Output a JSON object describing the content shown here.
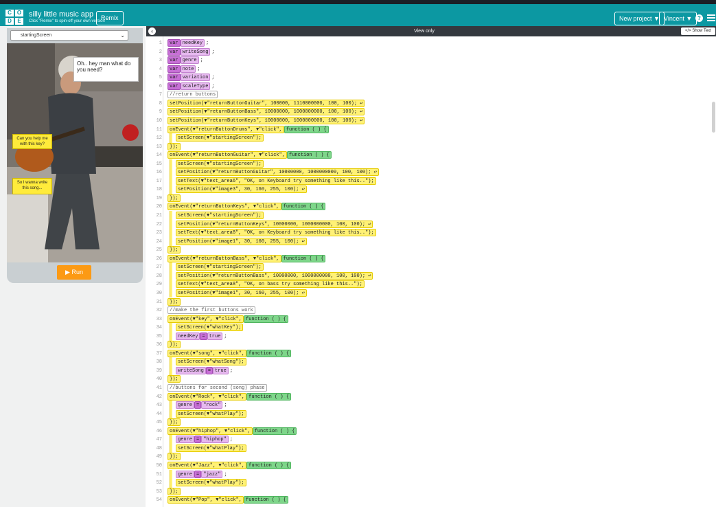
{
  "app": {
    "logo_letters": [
      "C",
      "O",
      "D",
      "E"
    ],
    "title": "silly little music app",
    "subtitle": "Click \"Remix\" to spin-off your own version",
    "remix_label": "Remix",
    "new_project_label": "New project ▼",
    "user_label": "Vincent ▼",
    "help_icon": "?",
    "colors": {
      "topbar": "#0c98a2",
      "run_button": "#fc9a14",
      "event_block": "#7ed68a",
      "ui_block": "#fff176",
      "variable_block": "#c76fd6"
    }
  },
  "sim": {
    "screen_select": "startingScreen",
    "bubble_main": "Oh.. hey man what do you need?",
    "bubble_key": "Can you help me with this key?",
    "bubble_song": "So I wanna write this song...",
    "run_label": "Run"
  },
  "editor": {
    "status": "View only",
    "show_text_label": "</> Show Text",
    "lines": [
      {
        "n": "1",
        "parts": [
          [
            "p",
            "var"
          ],
          [
            "pl",
            "needKey"
          ],
          [
            "t",
            ";"
          ]
        ]
      },
      {
        "n": "2",
        "parts": [
          [
            "p",
            "var"
          ],
          [
            "pl",
            "writeSong"
          ],
          [
            "t",
            ";"
          ]
        ]
      },
      {
        "n": "3",
        "parts": [
          [
            "p",
            "var"
          ],
          [
            "pl",
            "genre"
          ],
          [
            "t",
            ";"
          ]
        ]
      },
      {
        "n": "4",
        "parts": [
          [
            "p",
            "var"
          ],
          [
            "pl",
            "note"
          ],
          [
            "t",
            ";"
          ]
        ]
      },
      {
        "n": "5",
        "parts": [
          [
            "p",
            "var"
          ],
          [
            "pl",
            "variation"
          ],
          [
            "t",
            ";"
          ]
        ]
      },
      {
        "n": "6",
        "parts": [
          [
            "p",
            "var"
          ],
          [
            "pl",
            "scaleType"
          ],
          [
            "t",
            ";"
          ]
        ]
      },
      {
        "n": "7",
        "parts": [
          [
            "gr",
            "//return buttons"
          ]
        ]
      },
      {
        "n": "8",
        "parts": [
          [
            "y",
            "setPosition(▼\"returnButtonGuitar\", 100000, 1110000000, 100, 100); ↩"
          ]
        ]
      },
      {
        "n": "9",
        "parts": [
          [
            "y",
            "setPosition(▼\"returnButtonBass\", 10000000, 1000000000, 100, 100); ↩"
          ]
        ]
      },
      {
        "n": "10",
        "parts": [
          [
            "y",
            "setPosition(▼\"returnButtonKeys\", 10000000, 1000000000, 100, 100); ↩"
          ]
        ]
      },
      {
        "n": "11",
        "parts": [
          [
            "y",
            "onEvent(▼\"returnButtonDrums\", ▼\"click\","
          ],
          [
            "g",
            "function ( ) {"
          ]
        ]
      },
      {
        "n": "12",
        "ind": 1,
        "parts": [
          [
            "y",
            "setScreen(▼\"startingScreen\");"
          ]
        ]
      },
      {
        "n": "13",
        "parts": [
          [
            "y",
            "});"
          ]
        ]
      },
      {
        "n": "14",
        "parts": [
          [
            "y",
            "onEvent(▼\"returnButtonGuitar\", ▼\"click\","
          ],
          [
            "g",
            "function ( ) {"
          ]
        ]
      },
      {
        "n": "15",
        "ind": 1,
        "parts": [
          [
            "y",
            "setScreen(▼\"startingScreen\");"
          ]
        ]
      },
      {
        "n": "16",
        "ind": 1,
        "parts": [
          [
            "y",
            "setPosition(▼\"returnButtonGuitar\", 10000000, 1000000000, 100, 100); ↩"
          ]
        ]
      },
      {
        "n": "17",
        "ind": 1,
        "parts": [
          [
            "y",
            "setText(▼\"text_area6\", \"OK, on Keyboard try something like this..\");"
          ]
        ]
      },
      {
        "n": "18",
        "ind": 1,
        "parts": [
          [
            "y",
            "setPosition(▼\"image3\", 30, 160, 255, 100); ↩"
          ]
        ]
      },
      {
        "n": "19",
        "parts": [
          [
            "y",
            "});"
          ]
        ]
      },
      {
        "n": "20",
        "parts": [
          [
            "y",
            "onEvent(▼\"returnButtonKeys\", ▼\"click\","
          ],
          [
            "g",
            "function ( ) {"
          ]
        ]
      },
      {
        "n": "21",
        "ind": 1,
        "parts": [
          [
            "y",
            "setScreen(▼\"startingScreen\");"
          ]
        ]
      },
      {
        "n": "22",
        "ind": 1,
        "parts": [
          [
            "y",
            "setPosition(▼\"returnButtonKeys\", 10000000, 1000000000, 100, 100); ↩"
          ]
        ]
      },
      {
        "n": "23",
        "ind": 1,
        "parts": [
          [
            "y",
            "setText(▼\"text_area8\", \"OK, on Keyboard try something like this..\");"
          ]
        ]
      },
      {
        "n": "24",
        "ind": 1,
        "parts": [
          [
            "y",
            "setPosition(▼\"image1\", 30, 160, 255, 100); ↩"
          ]
        ]
      },
      {
        "n": "25",
        "parts": [
          [
            "y",
            "});"
          ]
        ]
      },
      {
        "n": "26",
        "parts": [
          [
            "y",
            "onEvent(▼\"returnButtonBass\", ▼\"click\","
          ],
          [
            "g",
            "function ( ) {"
          ]
        ]
      },
      {
        "n": "27",
        "ind": 1,
        "parts": [
          [
            "y",
            "setScreen(▼\"startingScreen\");"
          ]
        ]
      },
      {
        "n": "28",
        "ind": 1,
        "parts": [
          [
            "y",
            "setPosition(▼\"returnButtonBass\", 10000000, 1000000000, 100, 100); ↩"
          ]
        ]
      },
      {
        "n": "29",
        "ind": 1,
        "parts": [
          [
            "y",
            "setText(▼\"text_area8\", \"OK, on bass try something like this..\");"
          ]
        ]
      },
      {
        "n": "30",
        "ind": 1,
        "parts": [
          [
            "y",
            "setPosition(▼\"image1\", 30, 160, 255, 100); ↩"
          ]
        ]
      },
      {
        "n": "31",
        "parts": [
          [
            "y",
            "});"
          ]
        ]
      },
      {
        "n": "32",
        "parts": [
          [
            "gr",
            "//make the first buttons work"
          ]
        ]
      },
      {
        "n": "33",
        "parts": [
          [
            "y",
            "onEvent(▼\"key\", ▼\"click\","
          ],
          [
            "g",
            "function ( ) {"
          ]
        ]
      },
      {
        "n": "34",
        "ind": 1,
        "parts": [
          [
            "y",
            "setScreen(▼\"whatKey\");"
          ]
        ]
      },
      {
        "n": "35",
        "ind": 1,
        "parts": [
          [
            "pl",
            "needKey"
          ],
          [
            "p",
            "="
          ],
          [
            "pl",
            "true"
          ],
          [
            "t",
            ";"
          ]
        ]
      },
      {
        "n": "36",
        "parts": [
          [
            "y",
            "});"
          ]
        ]
      },
      {
        "n": "37",
        "parts": [
          [
            "y",
            "onEvent(▼\"song\", ▼\"click\","
          ],
          [
            "g",
            "function ( ) {"
          ]
        ]
      },
      {
        "n": "38",
        "ind": 1,
        "parts": [
          [
            "y",
            "setScreen(▼\"whatSong\");"
          ]
        ]
      },
      {
        "n": "39",
        "ind": 1,
        "parts": [
          [
            "pl",
            "writeSong"
          ],
          [
            "p",
            "="
          ],
          [
            "pl",
            "true"
          ],
          [
            "t",
            ";"
          ]
        ]
      },
      {
        "n": "40",
        "parts": [
          [
            "y",
            "});"
          ]
        ]
      },
      {
        "n": "41",
        "parts": [
          [
            "gr",
            "//buttons for second (song) phase"
          ]
        ]
      },
      {
        "n": "42",
        "parts": [
          [
            "y",
            "onEvent(▼\"Rock\", ▼\"click\","
          ],
          [
            "g",
            "function ( ) {"
          ]
        ]
      },
      {
        "n": "43",
        "ind": 1,
        "parts": [
          [
            "pl",
            "genre"
          ],
          [
            "p",
            "="
          ],
          [
            "pl",
            "\"rock\""
          ],
          [
            "t",
            ";"
          ]
        ]
      },
      {
        "n": "44",
        "ind": 1,
        "parts": [
          [
            "y",
            "setScreen(▼\"whatPlay\");"
          ]
        ]
      },
      {
        "n": "45",
        "parts": [
          [
            "y",
            "});"
          ]
        ]
      },
      {
        "n": "46",
        "parts": [
          [
            "y",
            "onEvent(▼\"hiphop\", ▼\"click\","
          ],
          [
            "g",
            "function ( ) {"
          ]
        ]
      },
      {
        "n": "47",
        "ind": 1,
        "parts": [
          [
            "pl",
            "genre"
          ],
          [
            "p",
            "="
          ],
          [
            "pl",
            "\"hiphop\""
          ],
          [
            "t",
            ";"
          ]
        ]
      },
      {
        "n": "48",
        "ind": 1,
        "parts": [
          [
            "y",
            "setScreen(▼\"whatPlay\");"
          ]
        ]
      },
      {
        "n": "49",
        "parts": [
          [
            "y",
            "});"
          ]
        ]
      },
      {
        "n": "50",
        "parts": [
          [
            "y",
            "onEvent(▼\"Jazz\", ▼\"click\","
          ],
          [
            "g",
            "function ( ) {"
          ]
        ]
      },
      {
        "n": "51",
        "ind": 1,
        "parts": [
          [
            "pl",
            "genre"
          ],
          [
            "p",
            "="
          ],
          [
            "pl",
            "\"jazz\""
          ],
          [
            "t",
            ";"
          ]
        ]
      },
      {
        "n": "52",
        "ind": 1,
        "parts": [
          [
            "y",
            "setScreen(▼\"whatPlay\");"
          ]
        ]
      },
      {
        "n": "53",
        "parts": [
          [
            "y",
            "});"
          ]
        ]
      },
      {
        "n": "54",
        "parts": [
          [
            "y",
            "onEvent(▼\"Pop\", ▼\"click\","
          ],
          [
            "g",
            "function ( ) {"
          ]
        ]
      }
    ]
  }
}
